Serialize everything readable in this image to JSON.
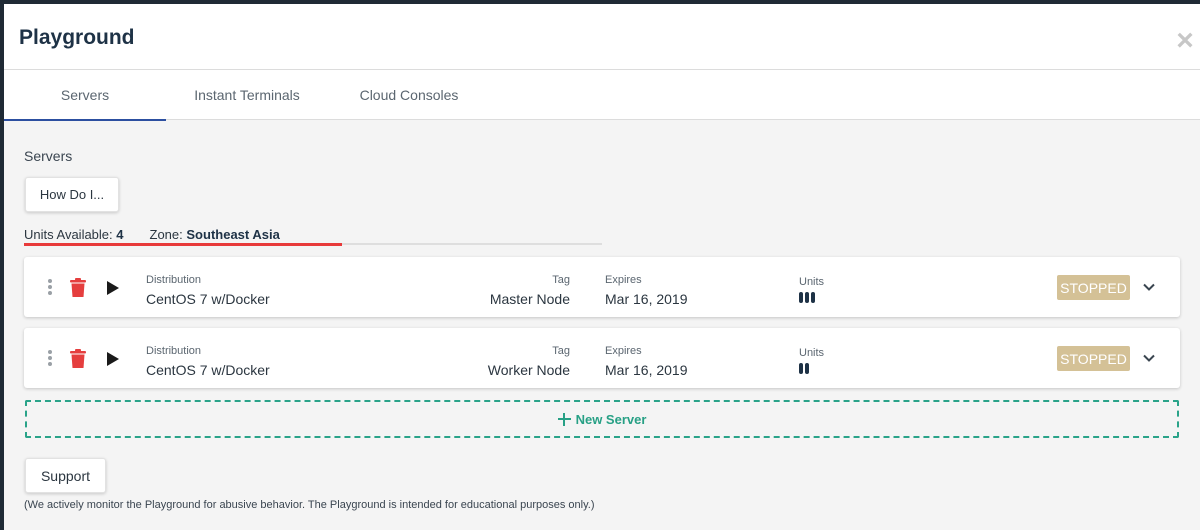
{
  "modal": {
    "title": "Playground",
    "close_icon": "close-icon"
  },
  "tabs": [
    {
      "label": "Servers",
      "active": true
    },
    {
      "label": "Instant Terminals",
      "active": false
    },
    {
      "label": "Cloud Consoles",
      "active": false
    }
  ],
  "section": {
    "title": "Servers",
    "how_do_label": "How Do I...",
    "units_label": "Units Available:",
    "units_value": "4",
    "zone_label": "Zone:",
    "zone_value": "Southeast Asia",
    "units_progress_fraction": 0.55
  },
  "servers": [
    {
      "distribution_label": "Distribution",
      "distribution": "CentOS 7 w/Docker",
      "tag_label": "Tag",
      "tag": "Master Node",
      "expires_label": "Expires",
      "expires": "Mar 16, 2019",
      "units_label": "Units",
      "units": 3,
      "status": "STOPPED"
    },
    {
      "distribution_label": "Distribution",
      "distribution": "CentOS 7 w/Docker",
      "tag_label": "Tag",
      "tag": "Worker Node",
      "expires_label": "Expires",
      "expires": "Mar 16, 2019",
      "units_label": "Units",
      "units": 2,
      "status": "STOPPED"
    }
  ],
  "new_server_label": "New Server",
  "support_label": "Support",
  "disclaimer": "(We actively monitor the Playground for abusive behavior. The Playground is intended for educational purposes only.)",
  "colors": {
    "accent_tab": "#2c4fa0",
    "progress": "#e83a3a",
    "status_stopped": "#d4c196",
    "new_server": "#27a085",
    "trash": "#e53e3e"
  }
}
